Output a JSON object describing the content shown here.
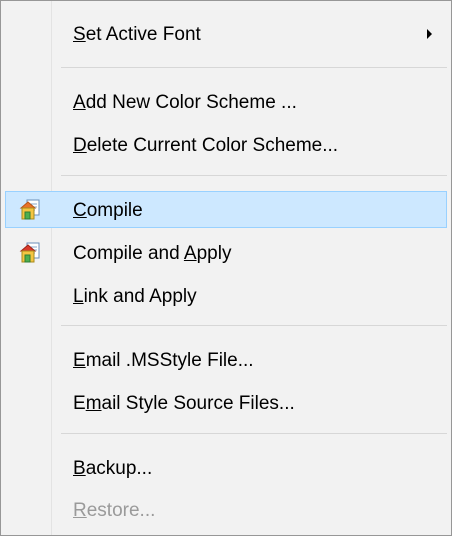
{
  "menu": {
    "items": [
      {
        "id": "set-active-font",
        "pre": "",
        "mnemonic": "S",
        "post": "et Active Font",
        "submenu": true,
        "disabled": false,
        "highlight": false,
        "icon": ""
      },
      {
        "id": "add-new-color-scheme",
        "pre": "",
        "mnemonic": "A",
        "post": "dd New Color Scheme ...",
        "submenu": false,
        "disabled": false,
        "highlight": false,
        "icon": ""
      },
      {
        "id": "delete-current-color-scheme",
        "pre": "",
        "mnemonic": "D",
        "post": "elete Current Color Scheme...",
        "submenu": false,
        "disabled": false,
        "highlight": false,
        "icon": ""
      },
      {
        "id": "compile",
        "pre": "",
        "mnemonic": "C",
        "post": "ompile",
        "submenu": false,
        "disabled": false,
        "highlight": true,
        "icon": "compile-icon"
      },
      {
        "id": "compile-and-apply",
        "pre": "Compile and ",
        "mnemonic": "A",
        "post": "pply",
        "submenu": false,
        "disabled": false,
        "highlight": false,
        "icon": "compile-apply-icon"
      },
      {
        "id": "link-and-apply",
        "pre": "",
        "mnemonic": "L",
        "post": "ink and Apply",
        "submenu": false,
        "disabled": false,
        "highlight": false,
        "icon": ""
      },
      {
        "id": "email-msstyle-file",
        "pre": "",
        "mnemonic": "E",
        "post": "mail .MSStyle File...",
        "submenu": false,
        "disabled": false,
        "highlight": false,
        "icon": ""
      },
      {
        "id": "email-style-source-files",
        "pre": "E",
        "mnemonic": "m",
        "post": "ail Style Source Files...",
        "submenu": false,
        "disabled": false,
        "highlight": false,
        "icon": ""
      },
      {
        "id": "backup",
        "pre": "",
        "mnemonic": "B",
        "post": "ackup...",
        "submenu": false,
        "disabled": false,
        "highlight": false,
        "icon": ""
      },
      {
        "id": "restore",
        "pre": "",
        "mnemonic": "R",
        "post": "estore...",
        "submenu": false,
        "disabled": true,
        "highlight": false,
        "icon": ""
      }
    ]
  },
  "colors": {
    "highlight_bg": "#cde8ff",
    "highlight_border": "#99d1ff",
    "disabled_text": "#9a9a9a",
    "menu_bg": "#f2f2f2"
  }
}
